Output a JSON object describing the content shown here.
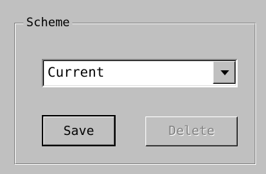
{
  "scheme_group": {
    "legend": "Scheme"
  },
  "scheme_select": {
    "value": "Current"
  },
  "buttons": {
    "save_label": "Save",
    "delete_label": "Delete",
    "delete_enabled": false
  },
  "colors": {
    "face": "#c0c0c0",
    "highlight": "#ffffff",
    "shadow": "#808080",
    "disabled_text": "#808080"
  },
  "icons": {
    "dropdown": "chevron-down-icon"
  }
}
